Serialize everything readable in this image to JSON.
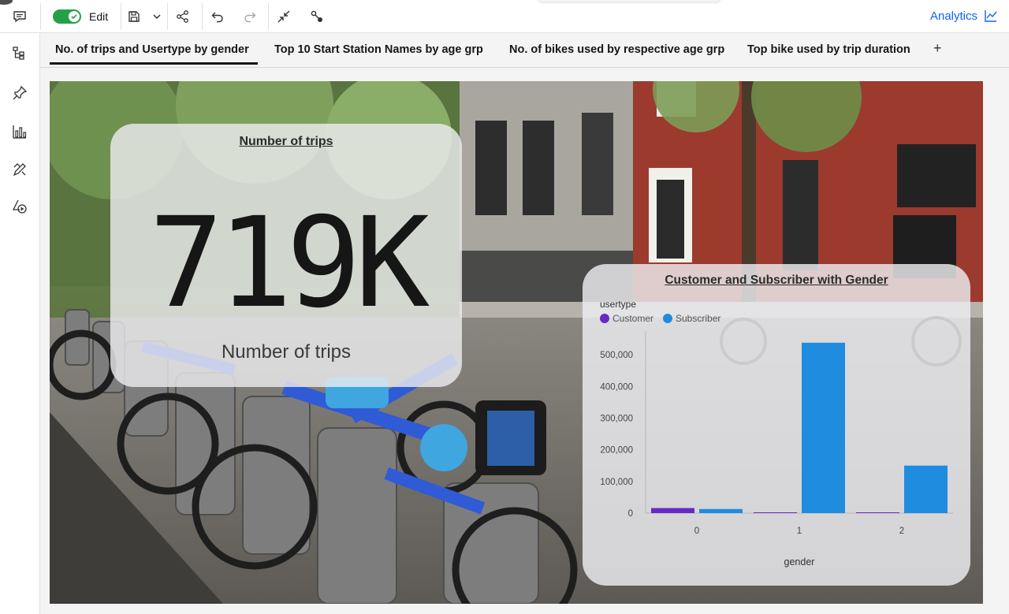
{
  "toolbar": {
    "edit_label": "Edit",
    "analytics_label": "Analytics",
    "icons": [
      "comment-icon",
      "save-icon",
      "chevron-down-icon",
      "share-icon",
      "undo-icon",
      "redo-icon",
      "collapse-icon",
      "connect-icon",
      "analytics-chart-icon"
    ]
  },
  "rail": {
    "items": [
      "hierarchy-icon",
      "pin-icon",
      "bar-chart-icon",
      "paint-tools-icon",
      "shapes-play-icon"
    ]
  },
  "tabs": [
    {
      "label": "No. of trips and Usertype by gender",
      "active": true
    },
    {
      "label": "Top 10 Start Station Names by age grp",
      "active": false
    },
    {
      "label": "No. of bikes used by respective age grp",
      "active": false
    },
    {
      "label": "Top bike used by trip duration",
      "active": false
    }
  ],
  "tab_add": "+",
  "kpi": {
    "title": "Number of trips",
    "value": "719K",
    "label": "Number of trips"
  },
  "chart": {
    "title": "Customer and Subscriber with Gender",
    "legend_title": "usertype",
    "xlabel": "gender"
  },
  "colors": {
    "customer": "#6929c4",
    "subscriber": "#1f8ce0",
    "accent": "#0f62fe",
    "toggle_on": "#24a148"
  },
  "chart_data": {
    "type": "bar",
    "categories": [
      "0",
      "1",
      "2"
    ],
    "series": [
      {
        "name": "Customer",
        "values": [
          16000,
          1500,
          1200
        ]
      },
      {
        "name": "Subscriber",
        "values": [
          13000,
          538000,
          150000
        ]
      }
    ],
    "xlabel": "gender",
    "ylabel": "",
    "ylim": [
      0,
      550000
    ],
    "yticks": [
      "0",
      "100,000",
      "200,000",
      "300,000",
      "400,000",
      "500,000"
    ],
    "legend_title": "usertype",
    "legend_position": "top-left",
    "grid": false
  }
}
